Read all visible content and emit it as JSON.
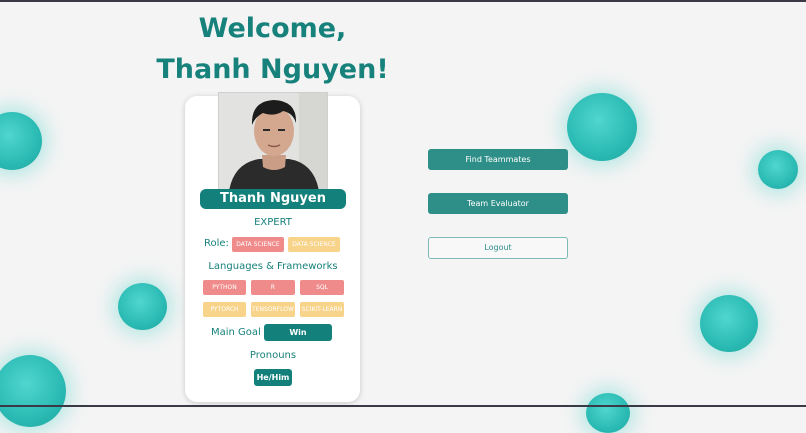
{
  "welcome": "Welcome, Thanh Nguyen!",
  "profile": {
    "name": "Thanh Nguyen",
    "level": "EXPERT",
    "role_label": "Role:",
    "roles": [
      "DATA SCIENCE",
      "DATA SCIENCE"
    ],
    "languages_heading": "Languages & Frameworks",
    "languages": [
      "PYTHON",
      "R",
      "SQL",
      "PYTORCH",
      "TENSORFLOW",
      "SCIKIT-LEARN"
    ],
    "goal_label": "Main Goal",
    "goal": "Win Hackathon",
    "pronouns_heading": "Pronouns",
    "pronouns": "He/Him"
  },
  "actions": {
    "find_teammates": "Find Teammates",
    "team_evaluator": "Team Evaluator",
    "logout": "Logout"
  },
  "colors": {
    "primary": "#13807b",
    "tag_red": "#f08b8b",
    "tag_yellow": "#f8d38a",
    "bubble": "#2bbbb4"
  }
}
